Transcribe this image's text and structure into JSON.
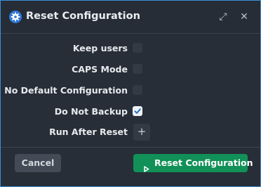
{
  "dialog": {
    "title": "Reset Configuration",
    "icon": "gear-icon",
    "accent_color": "#3d8fd6"
  },
  "window_controls": {
    "expand_icon": "⤢",
    "close_icon": "✕"
  },
  "options": [
    {
      "label": "Keep users",
      "checked": false
    },
    {
      "label": "CAPS Mode",
      "checked": false
    },
    {
      "label": "No Default Configuration",
      "checked": false
    },
    {
      "label": "Do Not Backup",
      "checked": true
    }
  ],
  "run_after_reset": {
    "label": "Run After Reset",
    "add_symbol": "+"
  },
  "footer": {
    "cancel_label": "Cancel",
    "confirm_label": "Reset Configuration",
    "confirm_color": "#119157"
  }
}
